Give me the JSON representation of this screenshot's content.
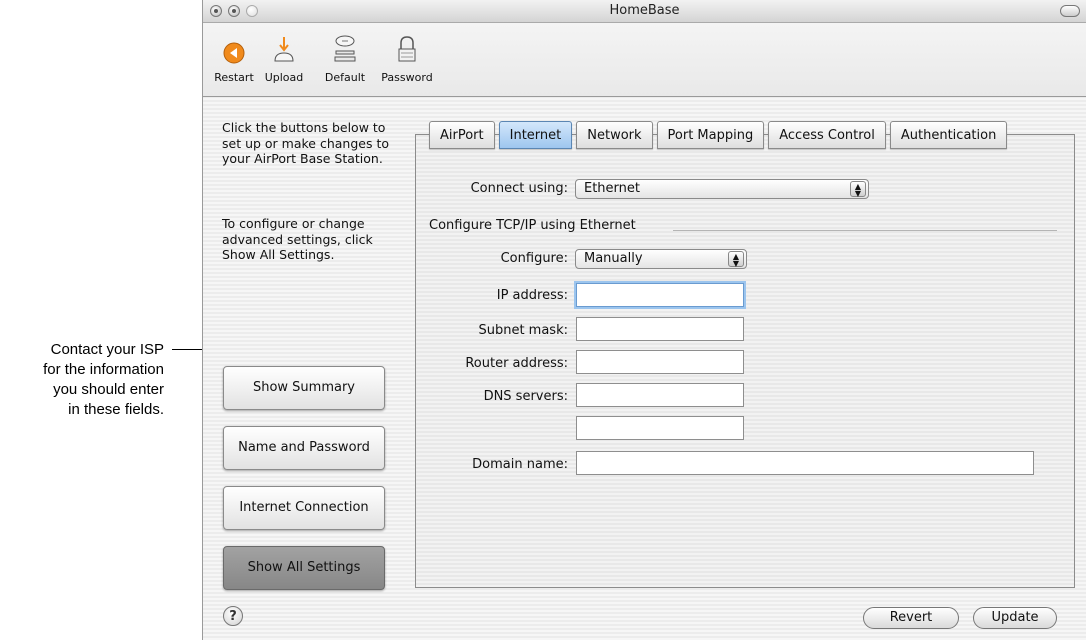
{
  "window": {
    "title": "HomeBase"
  },
  "toolbar": {
    "restart": "Restart",
    "upload": "Upload",
    "default": "Default",
    "password": "Password"
  },
  "sidebar": {
    "instructions": "Click the buttons below to set up or make changes to your AirPort Base Station.",
    "advanced_hint": "To configure or change advanced settings, click Show All Settings.",
    "buttons": [
      "Show Summary",
      "Name and Password",
      "Internet Connection",
      "Show All Settings"
    ],
    "active_button": "Show All Settings"
  },
  "tabs": [
    "AirPort",
    "Internet",
    "Network",
    "Port Mapping",
    "Access Control",
    "Authentication"
  ],
  "active_tab": "Internet",
  "form": {
    "connect_using_label": "Connect using:",
    "connect_using_value": "Ethernet",
    "group_label": "Configure TCP/IP using Ethernet",
    "configure_label": "Configure:",
    "configure_value": "Manually",
    "ip_address_label": "IP address:",
    "subnet_mask_label": "Subnet mask:",
    "router_address_label": "Router address:",
    "dns_servers_label": "DNS servers:",
    "domain_name_label": "Domain name:"
  },
  "footer": {
    "help": "?",
    "revert": "Revert",
    "update": "Update"
  },
  "callout": {
    "lines": [
      "Contact your ISP",
      "for the information",
      "you should enter",
      "in these fields."
    ]
  },
  "colors": {
    "accent": "#9ec6ef",
    "restart_icon": "#f08a1c"
  },
  "icons": [
    "restart-icon",
    "upload-icon",
    "default-icon",
    "password-icon",
    "help-icon",
    "popup-arrows-icon"
  ]
}
